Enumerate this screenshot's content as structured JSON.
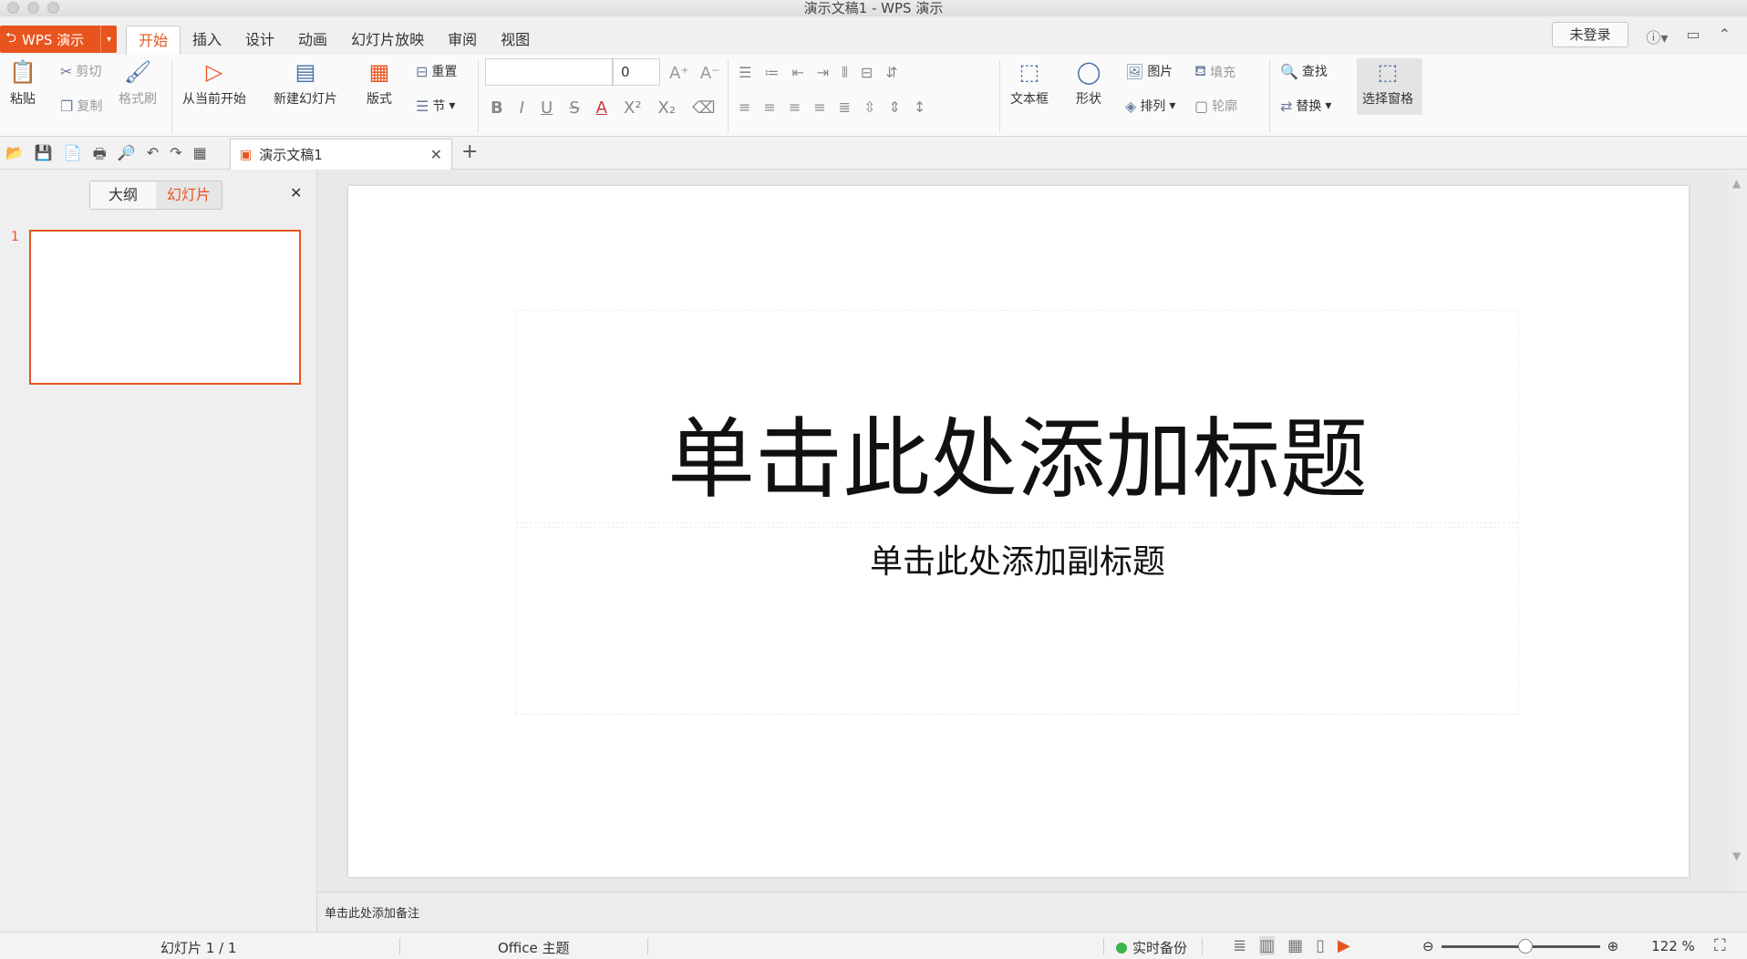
{
  "window": {
    "title": "演示文稿1 - WPS 演示"
  },
  "app_button": {
    "label": "WPS 演示"
  },
  "menu_tabs": [
    "开始",
    "插入",
    "设计",
    "动画",
    "幻灯片放映",
    "审阅",
    "视图"
  ],
  "login": {
    "label": "未登录"
  },
  "ribbon": {
    "paste": "粘贴",
    "cut": "剪切",
    "copy": "复制",
    "format_painter": "格式刷",
    "from_current": "从当前开始",
    "new_slide": "新建幻灯片",
    "layout": "版式",
    "reset": "重置",
    "section": "节",
    "font_size": "0",
    "text_box": "文本框",
    "shape": "形状",
    "picture": "图片",
    "arrange": "排列",
    "fill": "填充",
    "outline": "轮廓",
    "find": "查找",
    "replace": "替换",
    "selection_pane": "选择窗格"
  },
  "doc_tab": {
    "title": "演示文稿1"
  },
  "left_panel": {
    "tab_outline": "大纲",
    "tab_slides": "幻灯片",
    "slide_number": "1"
  },
  "slide": {
    "title_placeholder": "单击此处添加标题",
    "subtitle_placeholder": "单击此处添加副标题"
  },
  "notes": {
    "placeholder": "单击此处添加备注"
  },
  "status": {
    "slide_counter": "幻灯片 1 / 1",
    "theme": "Office 主题",
    "backup": "实时备份",
    "zoom": "122 %"
  },
  "colors": {
    "accent": "#e8541e",
    "backup_dot": "#3cb44b"
  }
}
